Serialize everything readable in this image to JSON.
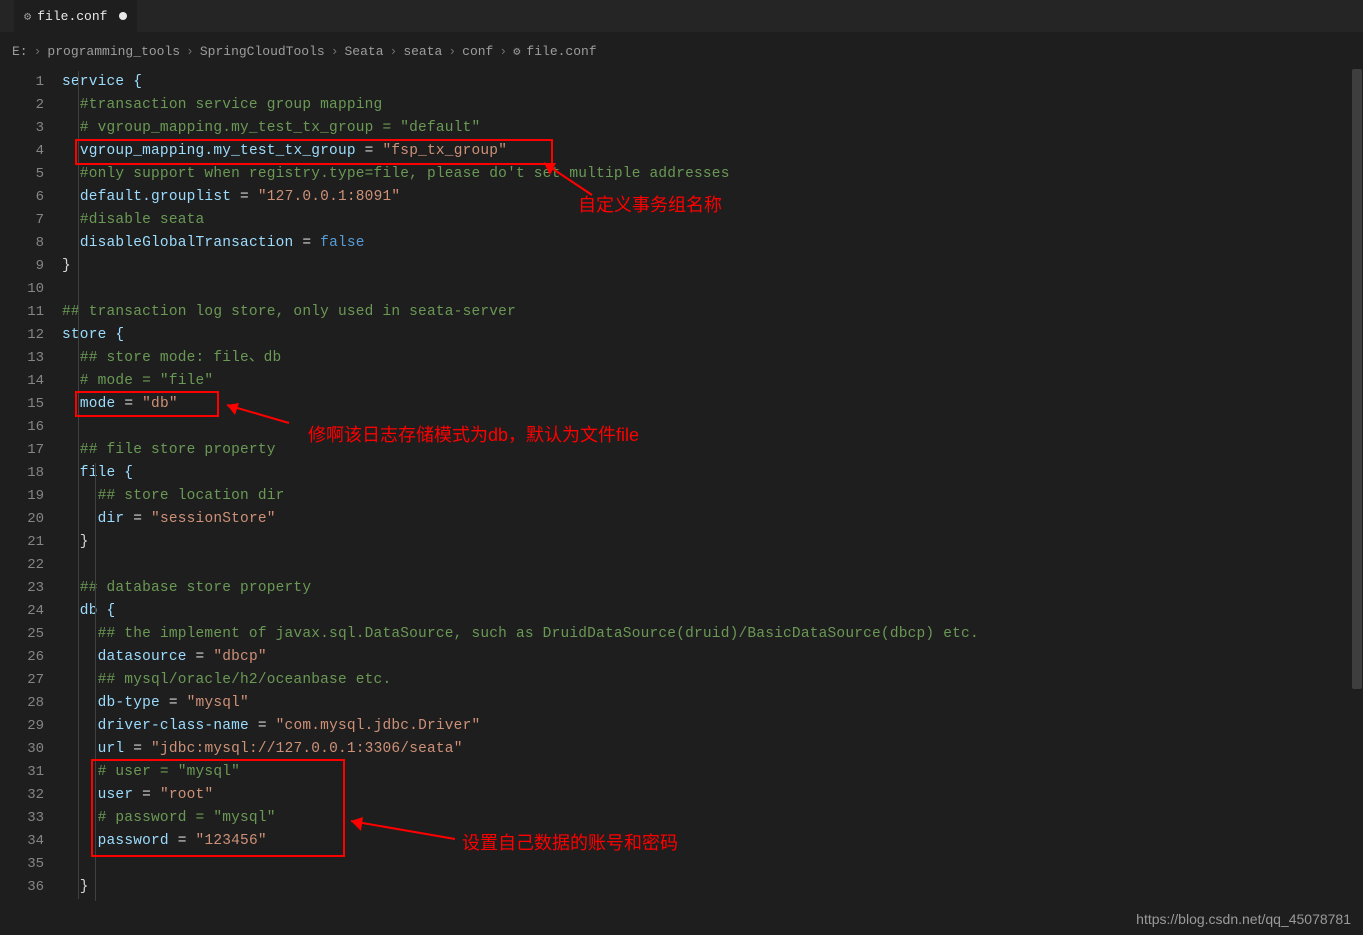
{
  "tab": {
    "filename": "file.conf",
    "modified": true
  },
  "breadcrumbs": {
    "items": [
      "E:",
      "programming_tools",
      "SpringCloudTools",
      "Seata",
      "seata",
      "conf"
    ],
    "leaf": "file.conf"
  },
  "line_numbers": [
    "1",
    "2",
    "3",
    "4",
    "5",
    "6",
    "7",
    "8",
    "9",
    "10",
    "11",
    "12",
    "13",
    "14",
    "15",
    "16",
    "17",
    "18",
    "19",
    "20",
    "21",
    "22",
    "23",
    "24",
    "25",
    "26",
    "27",
    "28",
    "29",
    "30",
    "31",
    "32",
    "33",
    "34",
    "35",
    "36"
  ],
  "code": {
    "l1": "service {",
    "l2": "  #transaction service group mapping",
    "l3": "  # vgroup_mapping.my_test_tx_group = \"default\"",
    "l4a": "  ",
    "l4b": "vgroup_mapping.my_test_tx_group",
    "l4c": " = ",
    "l4d": "\"fsp_tx_group\"",
    "l5": "  #only support when registry.type=file, please do't set multiple addresses",
    "l6a": "  ",
    "l6b": "default.grouplist",
    "l6c": " = ",
    "l6d": "\"127.0.0.1:8091\"",
    "l7": "  #disable seata",
    "l8a": "  ",
    "l8b": "disableGlobalTransaction",
    "l8c": " = ",
    "l8d": "false",
    "l9": "}",
    "l10": "",
    "l11": "## transaction log store, only used in seata-server",
    "l12": "store {",
    "l13": "  ## store mode: file、db",
    "l14": "  # mode = \"file\"",
    "l15a": "  ",
    "l15b": "mode",
    "l15c": " = ",
    "l15d": "\"db\"",
    "l16": "",
    "l17": "  ## file store property",
    "l18": "  file {",
    "l19": "    ## store location dir",
    "l20a": "    ",
    "l20b": "dir",
    "l20c": " = ",
    "l20d": "\"sessionStore\"",
    "l21": "  }",
    "l22": "",
    "l23": "  ## database store property",
    "l24": "  db {",
    "l25": "    ## the implement of javax.sql.DataSource, such as DruidDataSource(druid)/BasicDataSource(dbcp) etc.",
    "l26a": "    ",
    "l26b": "datasource",
    "l26c": " = ",
    "l26d": "\"dbcp\"",
    "l27": "    ## mysql/oracle/h2/oceanbase etc.",
    "l28a": "    ",
    "l28b": "db-type",
    "l28c": " = ",
    "l28d": "\"mysql\"",
    "l29a": "    ",
    "l29b": "driver-class-name",
    "l29c": " = ",
    "l29d": "\"com.mysql.jdbc.Driver\"",
    "l30a": "    ",
    "l30b": "url",
    "l30c": " = ",
    "l30d": "\"jdbc:mysql://127.0.0.1:3306/seata\"",
    "l31": "    # user = \"mysql\"",
    "l32a": "    ",
    "l32b": "user",
    "l32c": " = ",
    "l32d": "\"root\"",
    "l33": "    # password = \"mysql\"",
    "l34a": "    ",
    "l34b": "password",
    "l34c": " = ",
    "l34d": "\"123456\"",
    "l35": "",
    "l36": "  }"
  },
  "annotations": {
    "a1": "自定义事务组名称",
    "a2": "修啊该日志存储模式为db，默认为文件file",
    "a3": "设置自己数据的账号和密码"
  },
  "watermark": "https://blog.csdn.net/qq_45078781"
}
